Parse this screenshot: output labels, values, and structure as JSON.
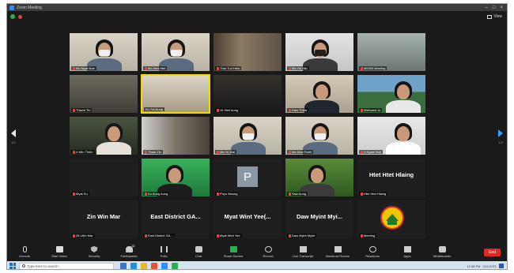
{
  "window": {
    "title": "Zoom Meeting"
  },
  "meeting": {
    "view_label": "View"
  },
  "gallery": {
    "prev_page": "1/2",
    "next_page": "1/2",
    "tiles": [
      {
        "name": "Ma Myat Noe",
        "kind": "video",
        "scene": "woman-mask",
        "muted": true
      },
      {
        "name": "Ma Htet Htet",
        "kind": "video",
        "scene": "woman-mask",
        "muted": true
      },
      {
        "name": "Thar Tun Hein",
        "kind": "video",
        "scene": "room",
        "muted": true
      },
      {
        "name": "Ma Yin Min",
        "kind": "video",
        "scene": "woman-mask-dark",
        "muted": true
      },
      {
        "name": "MMSB Meeting",
        "kind": "video",
        "scene": "hall",
        "muted": true
      },
      {
        "name": "Thazin Tin",
        "kind": "video",
        "scene": "group",
        "muted": true
      },
      {
        "name": "Ko Sai Aung",
        "kind": "video",
        "scene": "office",
        "muted": false,
        "active": true
      },
      {
        "name": "Ye Htet Aung",
        "kind": "video",
        "scene": "office-dark",
        "muted": true
      },
      {
        "name": "Daw Thida",
        "kind": "video",
        "scene": "man-suit",
        "muted": true
      },
      {
        "name": "Welcome to",
        "kind": "video",
        "scene": "presentation",
        "muted": true
      },
      {
        "name": "U Min Thein",
        "kind": "video",
        "scene": "man-glasses",
        "muted": true
      },
      {
        "name": "Thant Zin",
        "kind": "video",
        "scene": "room-window",
        "muted": true
      },
      {
        "name": "Ma Yu Wai",
        "kind": "video",
        "scene": "woman-mask",
        "muted": true
      },
      {
        "name": "Ma Moe Pwint",
        "kind": "video",
        "scene": "woman-mask",
        "muted": true
      },
      {
        "name": "U Kyaw Soe",
        "kind": "video",
        "scene": "man-plant",
        "muted": true
      },
      {
        "name": "Myat Su",
        "kind": "blank",
        "muted": true
      },
      {
        "name": "Ko Aung Aung",
        "kind": "video",
        "scene": "man-green",
        "muted": true
      },
      {
        "name": "Phyo Maung",
        "kind": "avatar",
        "letter": "P",
        "muted": true
      },
      {
        "name": "Saw Aung",
        "kind": "video",
        "scene": "man-outdoor",
        "muted": true
      },
      {
        "name": "Htet Htet Hlaing",
        "kind": "text",
        "big": "Htet Htet Hlaing",
        "muted": true
      },
      {
        "name": "Zin Win Mar",
        "kind": "text",
        "big": "Zin Win Mar",
        "muted": true
      },
      {
        "name": "East District GA...",
        "kind": "text",
        "big": "East District GA...",
        "muted": true
      },
      {
        "name": "Myat Wint Yee",
        "kind": "text",
        "big": "Myat Wint Yee(...",
        "muted": true
      },
      {
        "name": "Daw Myint Myint",
        "kind": "text",
        "big": "Daw Myint Myi...",
        "muted": true
      },
      {
        "name": "Meeting",
        "kind": "logo",
        "muted": true
      }
    ]
  },
  "toolbar": {
    "items": [
      {
        "label": "Unmute",
        "icon": "mic-icon"
      },
      {
        "label": "Start Video",
        "icon": "camera-icon"
      },
      {
        "label": "Security",
        "icon": "shield-icon"
      },
      {
        "label": "Participants",
        "icon": "participants-icon",
        "count": "32"
      },
      {
        "label": "Polls",
        "icon": "polls-icon"
      },
      {
        "label": "Chat",
        "icon": "chat-icon"
      },
      {
        "label": "Share Screen",
        "icon": "share-screen-icon"
      },
      {
        "label": "Record",
        "icon": "record-icon"
      },
      {
        "label": "Live Transcript",
        "icon": "transcript-icon"
      },
      {
        "label": "Breakout Rooms",
        "icon": "breakout-icon"
      },
      {
        "label": "Reactions",
        "icon": "reactions-icon"
      },
      {
        "label": "Apps",
        "icon": "apps-icon"
      },
      {
        "label": "Whiteboards",
        "icon": "whiteboard-icon"
      }
    ],
    "end_label": "End"
  },
  "taskbar": {
    "search_placeholder": "Type here to search",
    "time": "12:38 PM",
    "date": "5/11/2021"
  },
  "colors": {
    "accent": "#2d8cff",
    "end": "#e02828",
    "active_speaker": "#f5d800",
    "share": "#29b04e"
  }
}
